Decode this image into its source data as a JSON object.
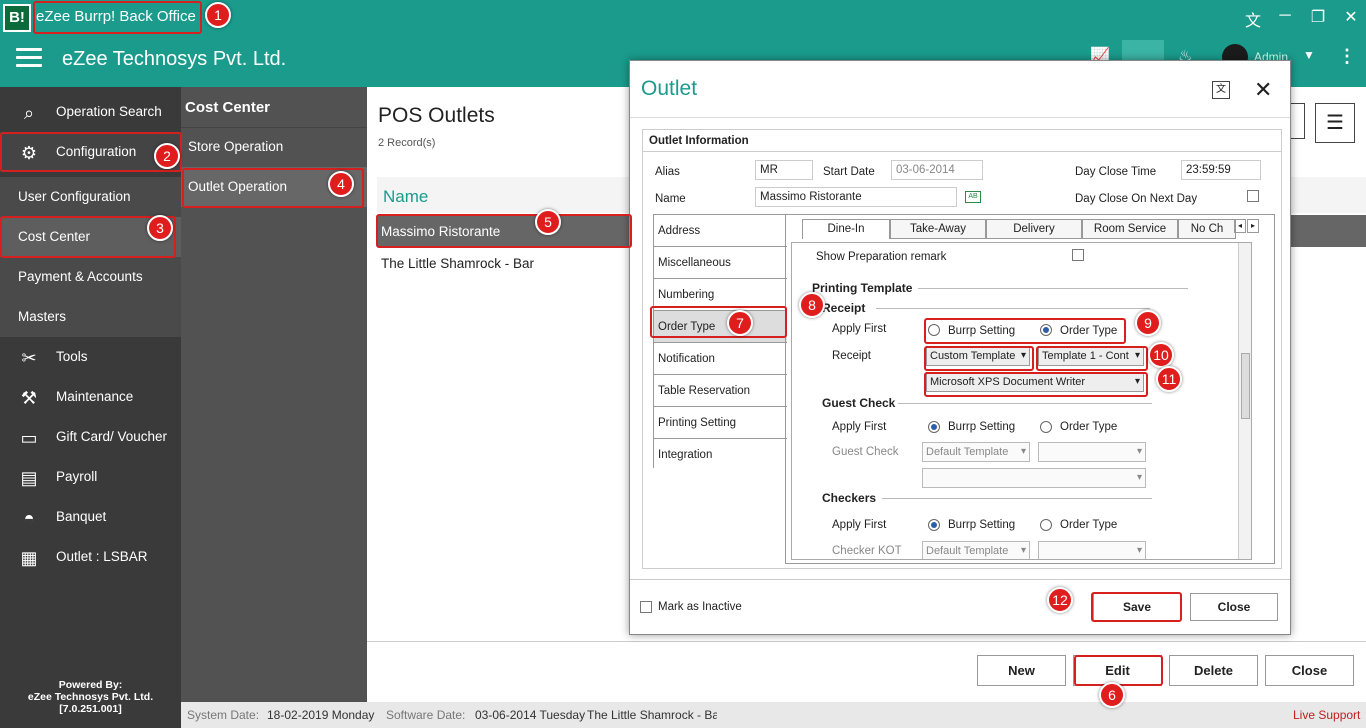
{
  "window": {
    "title": "eZee Burrp! Back Office",
    "logo_text": "B!"
  },
  "appbar": {
    "company": "eZee Technosys Pvt. Ltd.",
    "user": "Admin"
  },
  "sidebar": {
    "items": [
      {
        "label": "Operation Search"
      },
      {
        "label": "Configuration"
      },
      {
        "label": "User Configuration"
      },
      {
        "label": "Cost Center"
      },
      {
        "label": "Payment & Accounts"
      },
      {
        "label": "Masters"
      },
      {
        "label": "Tools"
      },
      {
        "label": "Maintenance"
      },
      {
        "label": "Gift Card/ Voucher"
      },
      {
        "label": "Payroll"
      },
      {
        "label": "Banquet"
      },
      {
        "label": "Outlet : LSBAR"
      }
    ],
    "powered_by": "Powered By:",
    "powered_company": "eZee Technosys Pvt. Ltd.",
    "version": "[7.0.251.001]"
  },
  "cost_center": {
    "title": "Cost Center",
    "items": [
      {
        "label": "Store Operation"
      },
      {
        "label": "Outlet Operation"
      }
    ]
  },
  "main": {
    "title": "POS Outlets",
    "records": "2 Record(s)",
    "column": "Name",
    "rows": [
      "Massimo Ristorante",
      "The Little Shamrock - Bar"
    ],
    "buttons": {
      "new": "New",
      "edit": "Edit",
      "delete": "Delete",
      "close": "Close"
    }
  },
  "status": {
    "system_date_label": "System Date:",
    "system_date": "18-02-2019 Monday",
    "software_date_label": "Software Date:",
    "software_date": "03-06-2014 Tuesday",
    "outlet": "The Little Shamrock - Bar",
    "live_support": "Live Support"
  },
  "dialog": {
    "title": "Outlet",
    "section": "Outlet Information",
    "alias_label": "Alias",
    "alias": "MR",
    "start_date_label": "Start Date",
    "start_date": "03-06-2014",
    "day_close_time_label": "Day Close Time",
    "day_close_time": "23:59:59",
    "name_label": "Name",
    "name": "Massimo Ristorante",
    "day_close_next_label": "Day Close On Next Day",
    "left_tabs": [
      "Address",
      "Miscellaneous",
      "Numbering",
      "Order Type",
      "Notification",
      "Table Reservation",
      "Printing Setting",
      "Integration"
    ],
    "top_tabs": [
      "Dine-In",
      "Take-Away",
      "Delivery",
      "Room Service",
      "No Ch"
    ],
    "show_prep": "Show Preparation remark",
    "printing_template": "Printing Template",
    "receipt_section": "Receipt",
    "apply_first": "Apply First",
    "burrp_setting": "Burrp Setting",
    "order_type": "Order Type",
    "receipt_label": "Receipt",
    "receipt_template": "Custom Template",
    "receipt_template2": "Template 1 - Cont",
    "receipt_printer": "Microsoft XPS Document Writer",
    "guest_check_section": "Guest Check",
    "guest_check_label": "Guest Check",
    "default_template": "Default Template",
    "checkers_section": "Checkers",
    "checker_kot": "Checker KOT",
    "mark_inactive": "Mark as Inactive",
    "save": "Save",
    "close": "Close"
  },
  "annotations": [
    "1",
    "2",
    "3",
    "4",
    "5",
    "6",
    "7",
    "8",
    "9",
    "10",
    "11",
    "12"
  ],
  "colors": {
    "brand": "#1a9b8c",
    "sidebar": "#3a3a3a",
    "annotation": "#e01d1d"
  }
}
